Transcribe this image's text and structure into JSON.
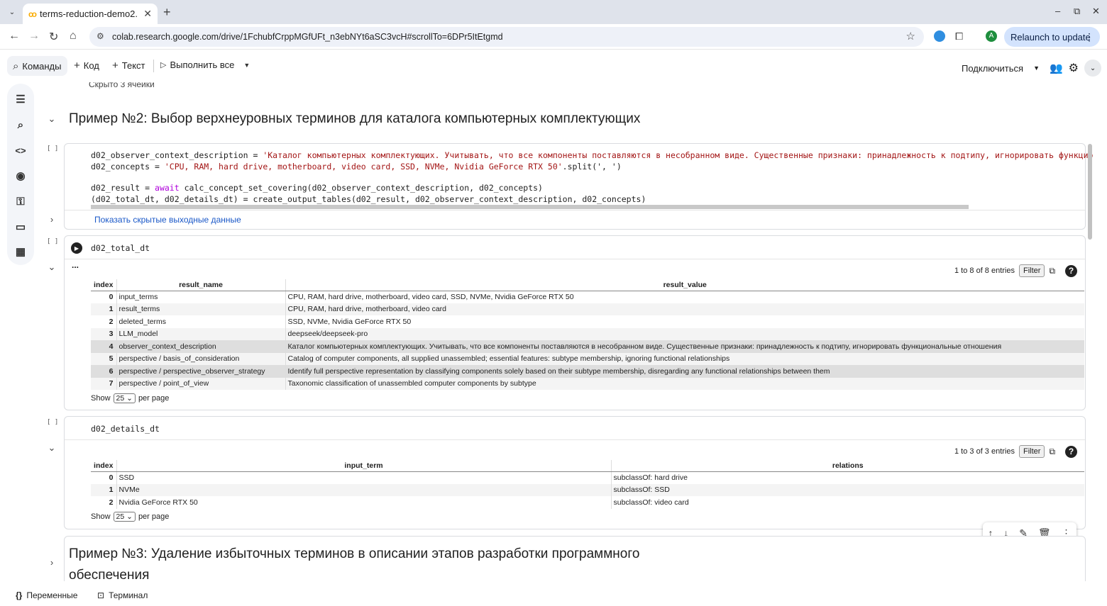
{
  "browser": {
    "tab_title": "terms-reduction-demo2.",
    "url": "colab.research.google.com/drive/1FchubfCrppMGfUFt_n3ebNYt6aSC3vcH#scrollTo=6DPr5ItEtgmd",
    "relaunch_label": "Relaunch to update",
    "profile_initial": "A"
  },
  "colab": {
    "commands_label": "Команды",
    "code_label": "Код",
    "text_label": "Текст",
    "run_all_label": "Выполнить все",
    "connect_label": "Подключиться"
  },
  "notebook": {
    "hidden_prev_text": "Скрыто 3 ячейки",
    "section2_title": "Пример №2: Выбор верхнеуровных терминов для каталога компьютерных комплектующих",
    "cell1": {
      "bracket": "[ ]",
      "line1_a": "d02_observer_context_description = ",
      "line1_s": "'Каталог компьютерных комплектующих. Учитывать, что все компоненты поставляются в несобранном виде. Существенные признаки: принадлежность к подтипу, игнорировать функцио",
      "line2_a": "d02_concepts = ",
      "line2_s": "'CPU, RAM, hard drive, motherboard, video card, SSD, NVMe, Nvidia GeForce RTX 50'",
      "line2_b": ".split(', ')",
      "line3_a": "d02_result = ",
      "line3_k": "await",
      "line3_b": " calc_concept_set_covering(d02_observer_context_description, d02_concepts)",
      "line4": "(d02_total_dt, d02_details_dt) = create_output_tables(d02_result, d02_observer_context_description, d02_concepts)",
      "show_hidden_outputs": "Показать скрытые выходные данные"
    },
    "cell2": {
      "bracket": "[ ]",
      "code": "d02_total_dt",
      "output_dots": "...",
      "entries_info": "1 to 8 of 8 entries",
      "filter_label": "Filter",
      "columns": [
        "index",
        "result_name",
        "result_value"
      ],
      "rows": [
        [
          "0",
          "input_terms",
          "CPU, RAM, hard drive, motherboard, video card, SSD, NVMe, Nvidia GeForce RTX 50"
        ],
        [
          "1",
          "result_terms",
          "CPU, RAM, hard drive, motherboard, video card"
        ],
        [
          "2",
          "deleted_terms",
          "SSD, NVMe, Nvidia GeForce RTX 50"
        ],
        [
          "3",
          "LLM_model",
          "deepseek/deepseek-pro"
        ],
        [
          "4",
          "observer_context_description",
          "Каталог компьютерных комплектующих. Учитывать, что все компоненты поставляются в несобранном виде. Существенные признаки: принадлежность к подтипу, игнорировать функциональные отношения"
        ],
        [
          "5",
          "perspective / basis_of_consideration",
          "Catalog of computer components, all supplied unassembled; essential features: subtype membership, ignoring functional relationships"
        ],
        [
          "6",
          "perspective / perspective_observer_strategy",
          "Identify full perspective representation by classifying components solely based on their subtype membership, disregarding any functional relationships between them"
        ],
        [
          "7",
          "perspective / point_of_view",
          "Taxonomic classification of unassembled computer components by subtype"
        ]
      ],
      "show_label": "Show",
      "per_page_value": "25",
      "per_page_label": "per page"
    },
    "cell3": {
      "bracket": "[ ]",
      "code": "d02_details_dt",
      "entries_info": "1 to 3 of 3 entries",
      "filter_label": "Filter",
      "columns": [
        "index",
        "input_term",
        "relations"
      ],
      "rows": [
        [
          "0",
          "SSD",
          "subclassOf: hard drive"
        ],
        [
          "1",
          "NVMe",
          "subclassOf: SSD"
        ],
        [
          "2",
          "Nvidia GeForce RTX 50",
          "subclassOf: video card"
        ]
      ],
      "show_label": "Show",
      "per_page_value": "25",
      "per_page_label": "per page"
    },
    "section3_title_line1": "Пример №3: Удаление избыточных терминов в описании этапов разработки программного",
    "section3_title_line2": "обеспечения"
  },
  "statusbar": {
    "variables_label": "Переменные",
    "terminal_label": "Терминал"
  },
  "colors": {
    "accent": "#1a58c8",
    "string": "#a31515",
    "keyword": "#af00db",
    "relaunch_bg": "#d3e3fd"
  }
}
